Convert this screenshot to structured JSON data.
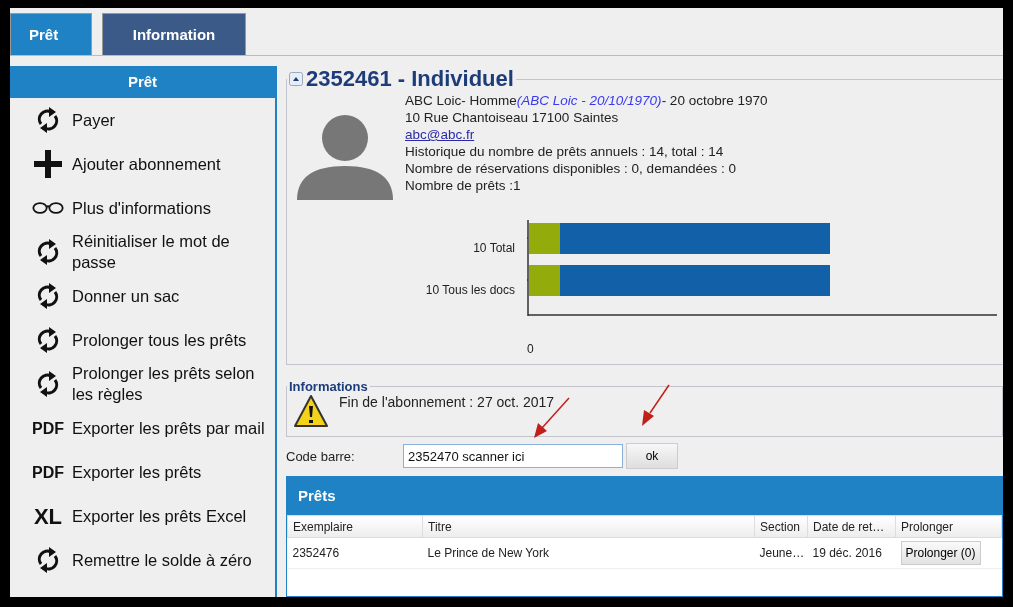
{
  "tabs": [
    {
      "label": "Prêt",
      "selected": true
    },
    {
      "label": "Information",
      "selected": false
    }
  ],
  "sidebar": {
    "title": "Prêt",
    "items": [
      {
        "kind": "refresh",
        "label": "Payer"
      },
      {
        "kind": "plus",
        "label": "Ajouter abonnement"
      },
      {
        "kind": "glasses",
        "label": "Plus d'informations"
      },
      {
        "kind": "refresh",
        "label": "Réinitialiser le mot de passe"
      },
      {
        "kind": "refresh",
        "label": "Donner un sac"
      },
      {
        "kind": "refresh",
        "label": "Prolonger tous les prêts"
      },
      {
        "kind": "refresh",
        "label": "Prolonger les prêts selon les règles"
      },
      {
        "kind": "text",
        "icon_text": "PDF",
        "label": "Exporter les prêts par mail"
      },
      {
        "kind": "text",
        "icon_text": "PDF",
        "label": "Exporter les prêts"
      },
      {
        "kind": "text",
        "icon_text": "XL",
        "label": "Exporter les prêts Excel"
      },
      {
        "kind": "refresh",
        "label": "Remettre le solde à zéro"
      }
    ]
  },
  "patron": {
    "title": "2352461 - Individuel",
    "name": "ABC Loic- Homme",
    "alias": "(ABC Loic - 20/10/1970)",
    "birth": "- 20 octobre 1970",
    "address": "10 Rue Chantoiseau 17100 Saintes",
    "email": "abc@abc.fr",
    "lines": [
      "Historique du nombre de prêts annuels : 14, total : 14",
      "Nombre de réservations disponibles : 0, demandées : 0",
      "Nombre de prêts :1"
    ],
    "bar_labels": [
      "10 Total",
      "10 Tous les docs"
    ],
    "axis_label": "0"
  },
  "informations": {
    "title": "Informations",
    "message": "Fin de l'abonnement : 27 oct. 2017"
  },
  "barcode": {
    "label": "Code barre:",
    "value": "2352470 scanner ici",
    "button": "ok"
  },
  "loans": {
    "title": "Prêts",
    "columns": [
      "Exemplaire",
      "Titre",
      "Section",
      "Date de ret…",
      "Prolonger"
    ],
    "rows": [
      {
        "cells": [
          "2352476",
          "Le Prince de New York",
          "Jeune…",
          "19 déc. 2016"
        ],
        "button": "Prolonger (0)"
      }
    ]
  }
}
